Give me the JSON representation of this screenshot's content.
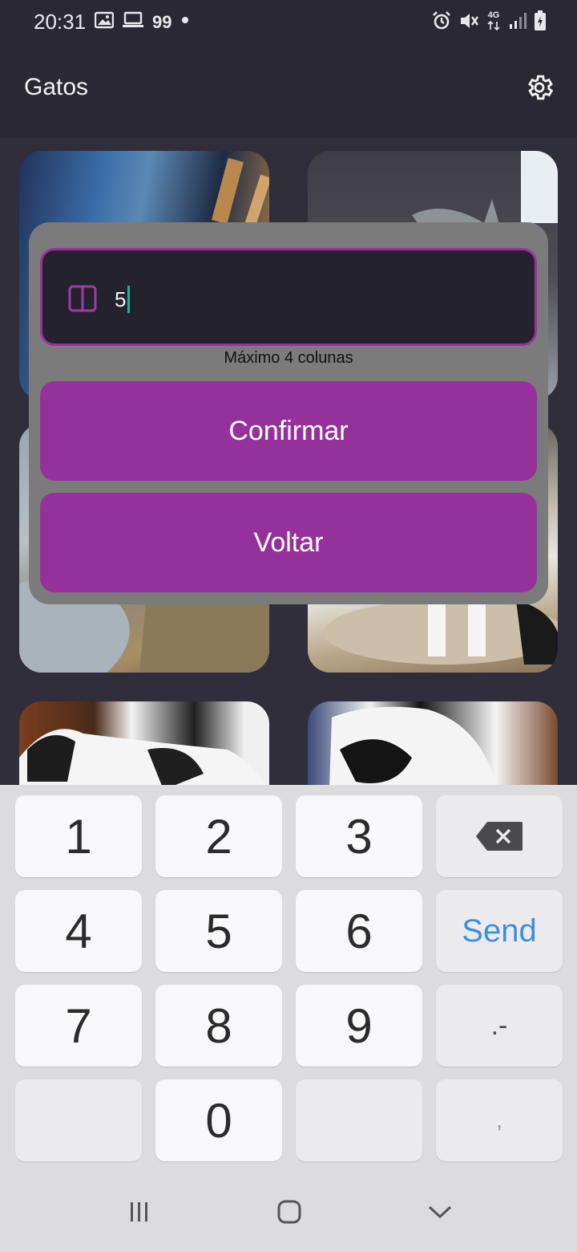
{
  "status_bar": {
    "time": "20:31",
    "left_icons": [
      "image-icon",
      "laptop-icon",
      "notification-dot-icon"
    ],
    "badge_text": "99",
    "network_label": "4G",
    "right_icons": [
      "alarm-icon",
      "mute-icon",
      "network-4g-icon",
      "signal-icon",
      "battery-charging-icon"
    ]
  },
  "app_bar": {
    "title": "Gatos",
    "settings_icon": "gear-icon"
  },
  "grid": {
    "images": [
      "cat-photo-1",
      "cat-photo-2",
      "cat-photo-3",
      "cat-photo-4",
      "cat-photo-5",
      "cat-photo-6"
    ]
  },
  "dialog": {
    "input_icon": "columns-icon",
    "input_value": "5",
    "helper_text": "Máximo 4 colunas",
    "confirm_label": "Confirmar",
    "back_label": "Voltar",
    "accent_color": "#95319b"
  },
  "keyboard": {
    "keys": [
      "1",
      "2",
      "3",
      "4",
      "5",
      "6",
      "7",
      "8",
      "9",
      "0"
    ],
    "send_label": "Send",
    "symbol_key": ".-",
    "comma_key": ",",
    "backspace_icon": "backspace-icon"
  },
  "navbar": {
    "icons": [
      "recent-apps-icon",
      "home-icon",
      "back-icon"
    ]
  }
}
